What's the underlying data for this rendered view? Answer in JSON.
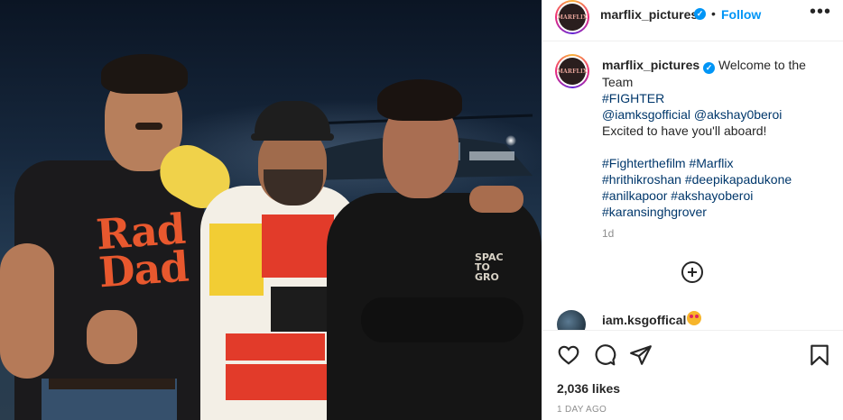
{
  "post": {
    "author": {
      "username": "marflix_pictures",
      "avatar_text": "MARFLIX",
      "verified": true
    },
    "header": {
      "separator": "•",
      "follow_label": "Follow",
      "more_icon": "more-horizontal-icon"
    },
    "photo": {
      "shirt_text_line1": "Rad",
      "shirt_text_line2": "Dad",
      "hoodie_text_line1": "SPAC",
      "hoodie_text_line2": "TO",
      "hoodie_text_line3": "GRO"
    },
    "caption": {
      "lines": [
        "Welcome to the",
        "Team",
        "#FIGHTER",
        "@iamksgofficial @akshay0beroi",
        "Excited to have you'll aboard!",
        "",
        "#Fighterthefilm #Marflix",
        "#hrithikroshan #deepikapadukone",
        "#anilkapoor #akshayoberoi",
        "#karansinghgrover"
      ],
      "time": "1d"
    },
    "load_more_icon": "plus-circle-icon",
    "comment_preview": {
      "username": "iam.ksgoffical",
      "emoji_icon": "heart-eyes-emoji-icon"
    },
    "actions": {
      "icons": [
        "heart-icon",
        "comment-icon",
        "share-icon",
        "bookmark-icon"
      ],
      "likes": "2,036 likes",
      "timestamp": "1 DAY AGO"
    },
    "colors": {
      "accent": "#0095f6",
      "hashtag": "#00376b",
      "secondary_text": "#8e8e8e",
      "border": "#efefef"
    }
  }
}
